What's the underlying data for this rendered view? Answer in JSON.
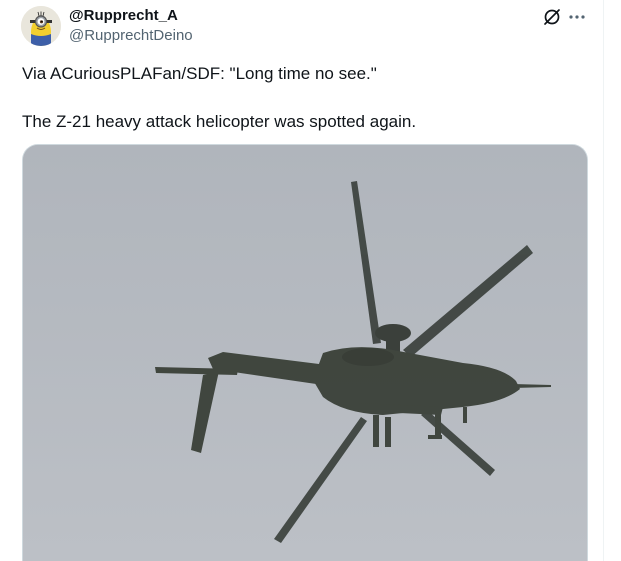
{
  "author": {
    "display_name": "@Rupprecht_A",
    "handle": "@RupprechtDeino",
    "avatar_icon": "minion-avatar"
  },
  "actions": {
    "grok_icon": "grok-icon",
    "more_icon": "more-dots-icon"
  },
  "tweet": {
    "line1": "Via ACuriousPLAFan/SDF: \"Long time no see.\"",
    "line2": "The Z-21 heavy attack helicopter was spotted again."
  },
  "media": {
    "subject_icon": "helicopter-photo"
  },
  "colors": {
    "text_primary": "#0f1419",
    "text_secondary": "#536471",
    "border": "#cfd9de",
    "sky": "#b4b9c0",
    "helicopter": "#3a4038"
  }
}
